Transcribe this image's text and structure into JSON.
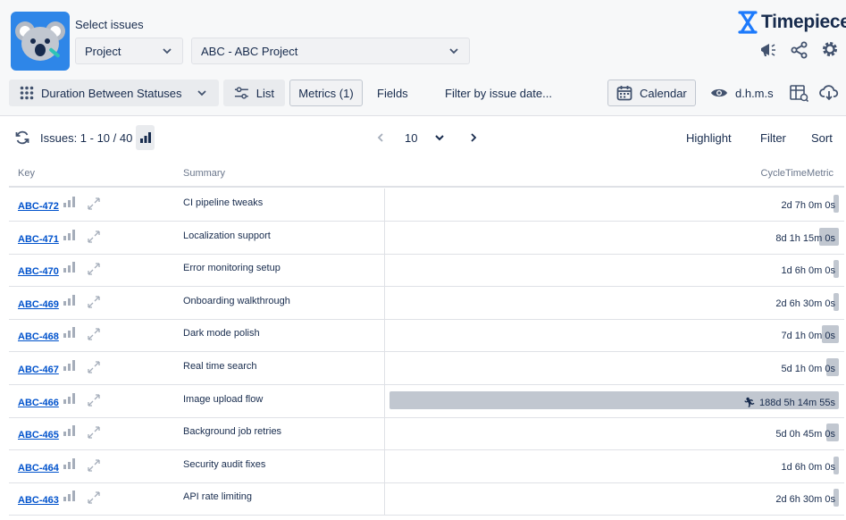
{
  "header": {
    "select_label": "Select issues",
    "project_dropdown": "Project",
    "project_value": "ABC - ABC Project",
    "brand_name": "Timepiece",
    "brand_color": "#1d7afc"
  },
  "toolbar": {
    "duration_label": "Duration Between Statuses",
    "list_label": "List",
    "metrics_label": "Metrics (1)",
    "fields_label": "Fields",
    "filter_date_label": "Filter by issue date...",
    "calendar_label": "Calendar",
    "format_label": "d.h.m.s"
  },
  "pager": {
    "issues_count": "Issues: 1 - 10 / 40",
    "page_size": "10",
    "highlight_label": "Highlight",
    "filter_label": "Filter",
    "sort_label": "Sort"
  },
  "table": {
    "columns": {
      "key": "Key",
      "summary": "Summary",
      "metric": "CycleTimeMetric"
    },
    "rows": [
      {
        "key": "ABC-472",
        "summary": "CI pipeline tweaks",
        "metric": "2d 7h 0m 0s",
        "fraction": 0.012
      },
      {
        "key": "ABC-471",
        "summary": "Localization support",
        "metric": "8d 1h 15m 0s",
        "fraction": 0.043
      },
      {
        "key": "ABC-470",
        "summary": "Error monitoring setup",
        "metric": "1d 6h 0m 0s",
        "fraction": 0.007
      },
      {
        "key": "ABC-469",
        "summary": "Onboarding walkthrough",
        "metric": "2d 6h 30m 0s",
        "fraction": 0.012
      },
      {
        "key": "ABC-468",
        "summary": "Dark mode polish",
        "metric": "7d 1h 0m 0s",
        "fraction": 0.037
      },
      {
        "key": "ABC-467",
        "summary": "Real time search",
        "metric": "5d 1h 0m 0s",
        "fraction": 0.027
      },
      {
        "key": "ABC-466",
        "summary": "Image upload flow",
        "metric": "188d 5h 14m 55s",
        "fraction": 1.0
      },
      {
        "key": "ABC-465",
        "summary": "Background job retries",
        "metric": "5d 0h 45m 0s",
        "fraction": 0.027
      },
      {
        "key": "ABC-464",
        "summary": "Security audit fixes",
        "metric": "1d 6h 0m 0s",
        "fraction": 0.007
      },
      {
        "key": "ABC-463",
        "summary": "API rate limiting",
        "metric": "2d 6h 30m 0s",
        "fraction": 0.012
      }
    ]
  }
}
